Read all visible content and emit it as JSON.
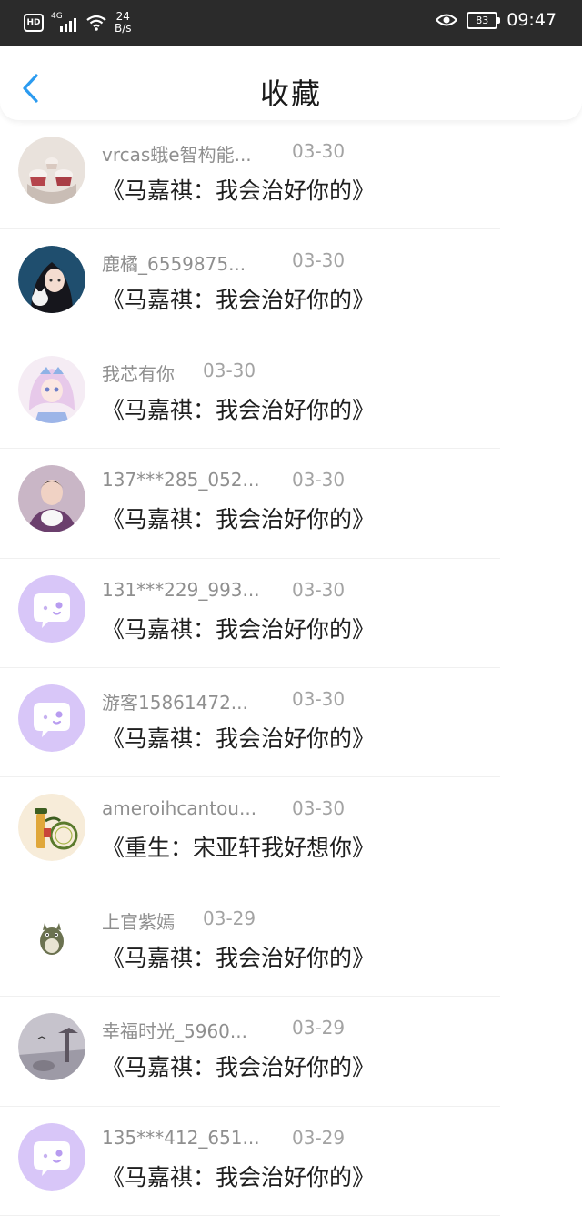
{
  "status_bar": {
    "hd": "HD",
    "network": "4G",
    "speed_value": "24",
    "speed_unit": "B/s",
    "battery": "83",
    "time": "09:47"
  },
  "header": {
    "title": "收藏"
  },
  "colors": {
    "accent": "#2b9bf0",
    "placeholder_avatar": "#d8c6f8",
    "status_bar": "#2b2b2b"
  },
  "items": [
    {
      "user": "vrcas蛾e智构能...",
      "date": "03-30",
      "book": "《马嘉祺：我会治好你的》",
      "avatar": "cupcakes"
    },
    {
      "user": "鹿橘_6559875...",
      "date": "03-30",
      "book": "《马嘉祺：我会治好你的》",
      "avatar": "girl-cat"
    },
    {
      "user": "我芯有你",
      "date": "03-30",
      "book": "《马嘉祺：我会治好你的》",
      "avatar": "anime-girl"
    },
    {
      "user": "137***285_052...",
      "date": "03-30",
      "book": "《马嘉祺：我会治好你的》",
      "avatar": "boy-photo"
    },
    {
      "user": "131***229_993...",
      "date": "03-30",
      "book": "《马嘉祺：我会治好你的》",
      "avatar": "default-chat"
    },
    {
      "user": "游客15861472...",
      "date": "03-30",
      "book": "《马嘉祺：我会治好你的》",
      "avatar": "default-chat"
    },
    {
      "user": "ameroihcantou...",
      "date": "03-30",
      "book": "《重生：宋亚轩我好想你》",
      "avatar": "bicycle"
    },
    {
      "user": "上官紫嫣",
      "date": "03-29",
      "book": "《马嘉祺：我会治好你的》",
      "avatar": "totoro"
    },
    {
      "user": "幸福时光_5960...",
      "date": "03-29",
      "book": "《马嘉祺：我会治好你的》",
      "avatar": "scenery"
    },
    {
      "user": "135***412_651...",
      "date": "03-29",
      "book": "《马嘉祺：我会治好你的》",
      "avatar": "default-chat"
    }
  ]
}
